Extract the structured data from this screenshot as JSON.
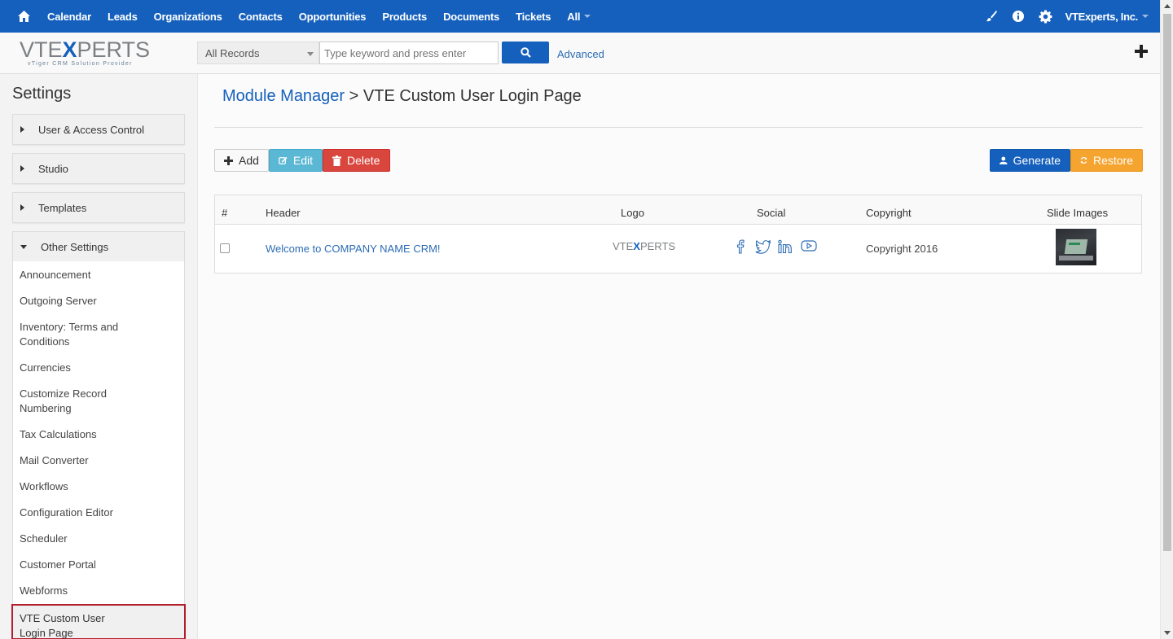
{
  "nav": {
    "items": [
      "Calendar",
      "Leads",
      "Organizations",
      "Contacts",
      "Opportunities",
      "Products",
      "Documents",
      "Tickets",
      "All"
    ],
    "company": "VTExperts, Inc.",
    "brand_color": "#1560bd"
  },
  "logo": {
    "part1": "VTE",
    "part2": "X",
    "part3": "PERTS",
    "tagline": "vTiger CRM Solution Provider"
  },
  "search": {
    "scope": "All Records",
    "placeholder": "Type keyword and press enter",
    "advanced_label": "Advanced"
  },
  "sidebar": {
    "title": "Settings",
    "groups": [
      "User & Access Control",
      "Studio",
      "Templates",
      "Other Settings"
    ],
    "items": [
      "Announcement",
      "Outgoing Server",
      "Inventory: Terms and Conditions",
      "Currencies",
      "Customize Record Numbering",
      "Tax Calculations",
      "Mail Converter",
      "Workflows",
      "Configuration Editor",
      "Scheduler",
      "Customer Portal",
      "Webforms"
    ],
    "active_item": "VTE Custom User Login Page"
  },
  "main": {
    "breadcrumb_link": "Module Manager",
    "breadcrumb_sep": ">",
    "breadcrumb_current": "VTE Custom User Login Page",
    "buttons": {
      "add": "Add",
      "edit": "Edit",
      "delete": "Delete",
      "generate": "Generate",
      "restore": "Restore"
    },
    "table": {
      "columns": [
        "#",
        "Header",
        "Logo",
        "Social",
        "Copyright",
        "Slide Images"
      ],
      "rows": [
        {
          "header": "Welcome to COMPANY NAME CRM!",
          "logo_text1": "VTE",
          "logo_text2": "X",
          "logo_text3": "PERTS",
          "social": [
            "facebook-icon",
            "twitter-icon",
            "linkedin-icon",
            "youtube-icon"
          ],
          "copyright": "Copyright 2016"
        }
      ]
    }
  }
}
